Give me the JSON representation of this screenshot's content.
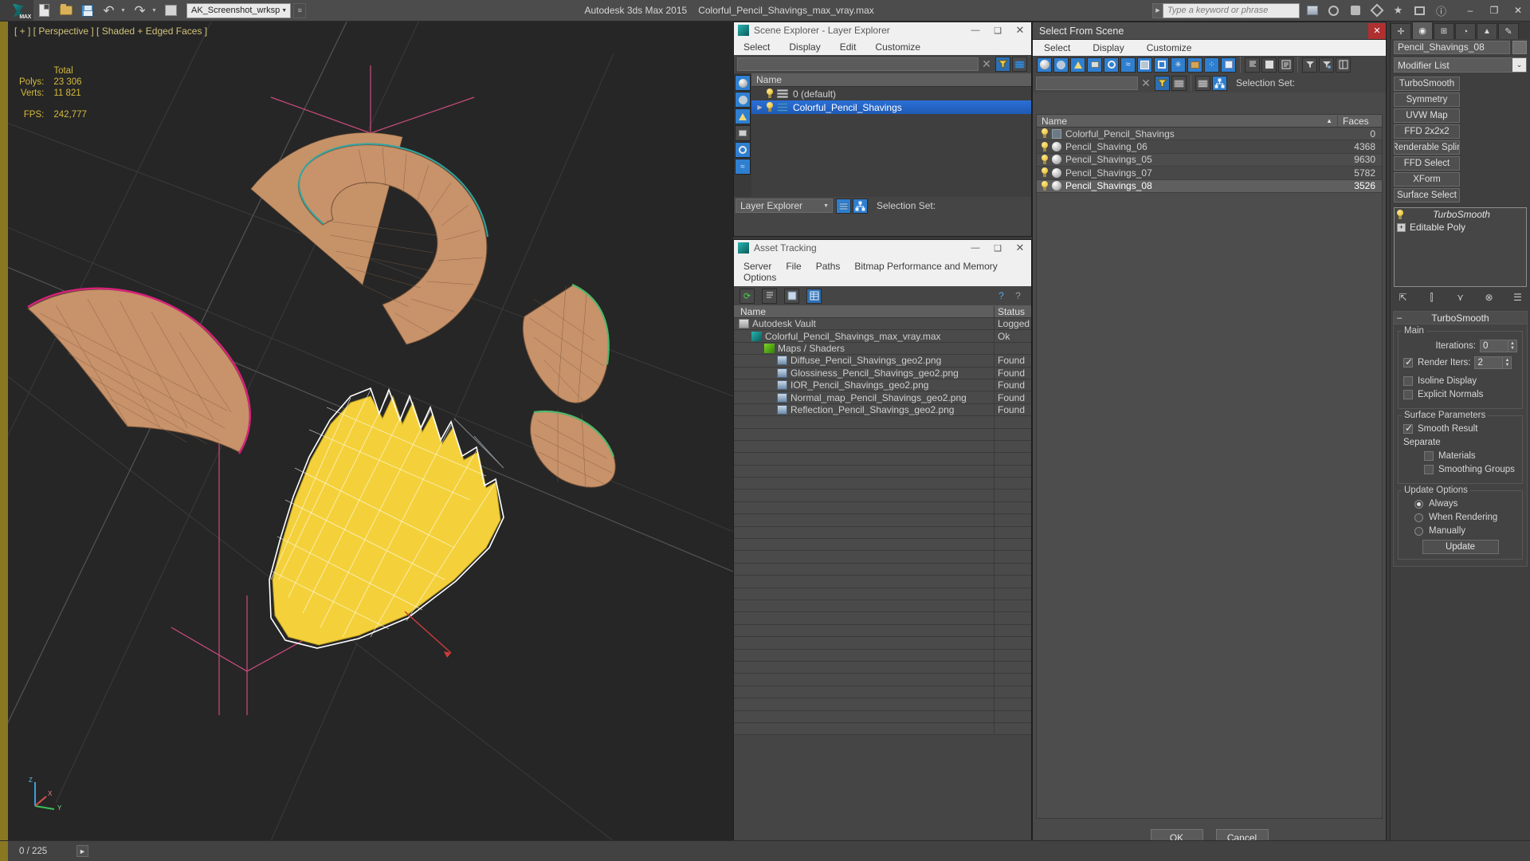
{
  "topbar": {
    "app_logo": "3dsmax-logo-icon",
    "quick_access": [
      {
        "name": "new-file-icon",
        "label": "New"
      },
      {
        "name": "open-file-icon",
        "label": "Open"
      },
      {
        "name": "save-file-icon",
        "label": "Save"
      },
      {
        "name": "undo-icon",
        "label": "Undo"
      },
      {
        "name": "redo-icon",
        "label": "Redo"
      },
      {
        "name": "project-folder-icon",
        "label": "Set Project Folder"
      }
    ],
    "workspace_value": "AK_Screenshot_wrksp",
    "app_title_product": "Autodesk 3ds Max  2015",
    "app_title_file": "Colorful_Pencil_Shavings_max_vray.max",
    "search_placeholder": "Type a keyword or phrase",
    "right_icons": [
      "workspace-grid-icon",
      "autodesk-360-icon",
      "help-sign-in-icon",
      "exchange-icon",
      "star-icon",
      "capture-icon",
      "info-icon"
    ],
    "window_minimize": "–",
    "window_restore": "❐",
    "window_close": "✕"
  },
  "viewport": {
    "label": "[ + ] [ Perspective ] [ Shaded + Edged Faces ]",
    "stats_header": "Total",
    "stats": [
      {
        "key": "Polys:",
        "value": "23 306"
      },
      {
        "key": "Verts:",
        "value": "11 821"
      }
    ],
    "fps_key": "FPS:",
    "fps_value": "242,777",
    "axis_labels": {
      "z": "Z",
      "y": "Y",
      "x": "X"
    }
  },
  "scene_explorer": {
    "title": "Scene Explorer - Layer Explorer",
    "title_icon": "3dsmax-window-icon",
    "window_buttons": {
      "minimize": "—",
      "maximize": "❑",
      "close": "✕"
    },
    "menus": [
      "Select",
      "Display",
      "Edit",
      "Customize"
    ],
    "filter_value": "",
    "clear_icon": "clear-x-icon",
    "toolbar_icons": [
      "filter-funnel-icon",
      "layers-icon"
    ],
    "sidebar_icons": [
      "geometry-icon",
      "shapes-icon",
      "lights-icon",
      "cameras-icon",
      "helpers-icon",
      "space-warps-icon"
    ],
    "column_header_name": "Name",
    "rows": [
      {
        "name": "0 (default)",
        "selected": false,
        "expandable": false,
        "layer_color": "grey"
      },
      {
        "name": "Colorful_Pencil_Shavings",
        "selected": true,
        "expandable": true,
        "layer_color": "blue"
      }
    ],
    "footer_combo": "Layer Explorer",
    "footer_selection_set_label": "Selection Set:",
    "footer_icons": [
      "layers-toggle-icon",
      "hierarchy-icon"
    ]
  },
  "asset_tracking": {
    "title": "Asset Tracking",
    "title_icon": "3dsmax-window-icon",
    "window_buttons": {
      "minimize": "—",
      "maximize": "❑",
      "close": "✕"
    },
    "menus": [
      "Server",
      "File",
      "Paths",
      "Bitmap Performance and Memory",
      "Options"
    ],
    "toolbar_icons": [
      "refresh-icon",
      "list-view-icon",
      "detail-view-icon",
      "table-view-icon",
      "help-add-icon",
      "help-query-icon"
    ],
    "columns": [
      "Name",
      "Status"
    ],
    "rows": [
      {
        "name": "Autodesk Vault",
        "status": "Logged",
        "indent": 0,
        "icon": "vault-icon"
      },
      {
        "name": "Colorful_Pencil_Shavings_max_vray.max",
        "status": "Ok",
        "indent": 1,
        "icon": "max-file-icon"
      },
      {
        "name": "Maps / Shaders",
        "status": "",
        "indent": 2,
        "icon": "maps-shaders-icon"
      },
      {
        "name": "Diffuse_Pencil_Shavings_geo2.png",
        "status": "Found",
        "indent": 3,
        "icon": "bitmap-icon"
      },
      {
        "name": "Glossiness_Pencil_Shavings_geo2.png",
        "status": "Found",
        "indent": 3,
        "icon": "bitmap-icon"
      },
      {
        "name": "IOR_Pencil_Shavings_geo2.png",
        "status": "Found",
        "indent": 3,
        "icon": "bitmap-icon"
      },
      {
        "name": "Normal_map_Pencil_Shavings_geo2.png",
        "status": "Found",
        "indent": 3,
        "icon": "bitmap-icon"
      },
      {
        "name": "Reflection_Pencil_Shavings_geo2.png",
        "status": "Found",
        "indent": 3,
        "icon": "bitmap-icon"
      }
    ],
    "scroll_left_icon": "◄",
    "scroll_right_icon": "►"
  },
  "select_from_scene": {
    "title": "Select From Scene",
    "close_label": "✕",
    "menus": [
      "Select",
      "Display",
      "Customize"
    ],
    "filter_toolbar_icons": [
      "geometry-filter-icon",
      "shapes-filter-icon",
      "lights-filter-icon",
      "cameras-filter-icon",
      "helpers-filter-icon",
      "space-warps-filter-icon",
      "groups-filter-icon",
      "xrefs-filter-icon",
      "bones-filter-icon",
      "container-filter-icon",
      "particles-filter-icon",
      "none-filter-icon",
      "display-flat-icon",
      "display-blank-icon",
      "display-list-icon",
      "filter-funnel-icon",
      "filter-advanced-icon",
      "columns-icon"
    ],
    "search_value": "",
    "clear_icon": "clear-x-icon",
    "second_toolbar_icons": [
      "filter-active-icon",
      "layers-icon",
      "layers-plain-icon",
      "hierarchy-icon"
    ],
    "selection_set_label": "Selection Set:",
    "columns": [
      "Name",
      "Faces"
    ],
    "sort_arrow": "▲",
    "rows": [
      {
        "name": "Colorful_Pencil_Shavings",
        "faces": "0",
        "icon": "group-icon",
        "selected": false
      },
      {
        "name": "Pencil_Shaving_06",
        "faces": "4368",
        "icon": "sphere-icon",
        "selected": false
      },
      {
        "name": "Pencil_Shavings_05",
        "faces": "9630",
        "icon": "sphere-icon",
        "selected": false
      },
      {
        "name": "Pencil_Shavings_07",
        "faces": "5782",
        "icon": "sphere-icon",
        "selected": false
      },
      {
        "name": "Pencil_Shavings_08",
        "faces": "3526",
        "icon": "sphere-icon",
        "selected": true
      }
    ],
    "buttons": {
      "ok": "OK",
      "cancel": "Cancel"
    }
  },
  "command_panel": {
    "tabs": [
      "create-tab-icon",
      "modify-tab-icon",
      "hierarchy-tab-icon",
      "motion-tab-icon",
      "display-tab-icon",
      "utilities-tab-icon"
    ],
    "active_tab_index": 1,
    "object_name": "Pencil_Shavings_08",
    "object_color": "#6e6e6e",
    "modifier_list_label": "Modifier List",
    "modifier_buttons": [
      "TurboSmooth",
      "Symmetry",
      "UVW Map",
      "FFD 2x2x2",
      "Renderable Splin",
      "FFD Select",
      "XForm",
      "Surface Select"
    ],
    "stack": [
      {
        "label": "TurboSmooth",
        "italic": true,
        "icon": "light-bulb-icon"
      },
      {
        "label": "Editable Poly",
        "italic": false,
        "icon": "plus-expand-icon"
      }
    ],
    "stack_tool_icons": [
      "pin-stack-icon",
      "show-end-result-icon",
      "make-unique-icon",
      "remove-modifier-icon",
      "configure-sets-icon"
    ],
    "turbosmooth": {
      "rollout_title": "TurboSmooth",
      "collapse_icon": "–",
      "main_group": "Main",
      "iterations_label": "Iterations:",
      "iterations_value": "0",
      "render_iters_label": "Render Iters:",
      "render_iters_value": "2",
      "render_iters_checked": true,
      "isoline_label": "Isoline Display",
      "isoline_checked": false,
      "explicit_normals_label": "Explicit Normals",
      "explicit_normals_checked": false,
      "surface_group": "Surface Parameters",
      "smooth_result_label": "Smooth Result",
      "smooth_result_checked": true,
      "separate_label": "Separate",
      "materials_label": "Materials",
      "materials_checked": false,
      "smoothing_groups_label": "Smoothing Groups",
      "smoothing_groups_checked": false,
      "update_group": "Update Options",
      "update_options": [
        {
          "label": "Always",
          "selected": true
        },
        {
          "label": "When Rendering",
          "selected": false
        },
        {
          "label": "Manually",
          "selected": false
        }
      ],
      "update_button": "Update"
    }
  },
  "status_bar": {
    "frame_counter": "0 / 225",
    "next_icon": "►"
  },
  "colors": {
    "accent_blue": "#2f7fd0",
    "selection_blue": "#2b6fd6",
    "viewport_bg": "#262626",
    "stat_yellow": "#d4b93c",
    "stripe_gold": "#8a7722",
    "panel_bg": "#3f3f3f"
  }
}
